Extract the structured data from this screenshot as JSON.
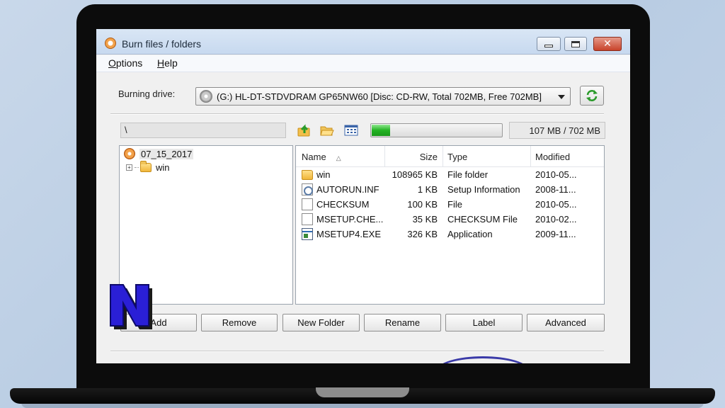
{
  "window": {
    "title": "Burn files / folders"
  },
  "menu": [
    {
      "label": "Options"
    },
    {
      "label": "Help"
    }
  ],
  "drive": {
    "label": "Burning drive:",
    "selected": "(G:) HL-DT-STDVDRAM GP65NW60 [Disc: CD-RW, Total 702MB, Free 702MB]"
  },
  "path": "\\",
  "capacity": {
    "used_fraction": 0.152,
    "text": "107 MB / 702 MB"
  },
  "tree": {
    "root": "07_15_2017",
    "children": [
      {
        "label": "win"
      }
    ]
  },
  "list": {
    "columns": [
      "Name",
      "Size",
      "Type",
      "Modified"
    ],
    "rows": [
      {
        "icon": "folder-icon",
        "name": "win",
        "size": "108965 KB",
        "type": "File folder",
        "modified": "2010-05..."
      },
      {
        "icon": "setup-info-icon",
        "name": "AUTORUN.INF",
        "size": "1 KB",
        "type": "Setup Information",
        "modified": "2008-11..."
      },
      {
        "icon": "file-icon",
        "name": "CHECKSUM",
        "size": "100 KB",
        "type": "File",
        "modified": "2010-05..."
      },
      {
        "icon": "file-icon",
        "name": "MSETUP.CHE...",
        "size": "35 KB",
        "type": "CHECKSUM File",
        "modified": "2010-02..."
      },
      {
        "icon": "application-icon",
        "name": "MSETUP4.EXE",
        "size": "326 KB",
        "type": "Application",
        "modified": "2009-11..."
      }
    ]
  },
  "buttons": {
    "add": "Add",
    "remove": "Remove",
    "new_folder": "New Folder",
    "rename": "Rename",
    "label": "Label",
    "advanced": "Advanced"
  },
  "colors": {
    "progress": "#23b323",
    "titlebar": "#c7d9ef",
    "logo_fill": "#2a1fd6",
    "close": "#c8432b"
  }
}
